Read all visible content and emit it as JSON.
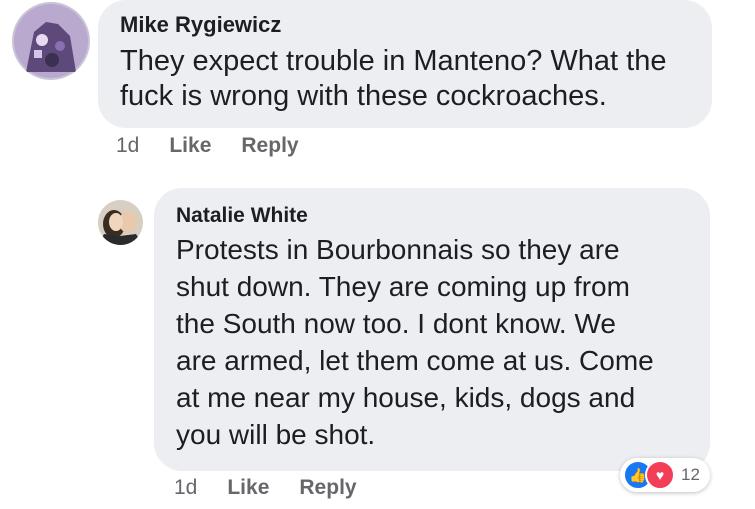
{
  "comments": [
    {
      "author": "Mike Rygiewicz",
      "text": "They expect trouble in Manteno? What the\nfuck is wrong with these cockroaches.",
      "time": "1d",
      "like_label": "Like",
      "reply_label": "Reply"
    },
    {
      "author": "Natalie White",
      "text": "Protests in Bourbonnais so they are\nshut down.  They are coming up from\nthe South now too.  I dont know.  We\nare armed, let them come at us. Come\nat me near my house, kids, dogs and\nyou will be shot.",
      "time": "1d",
      "like_label": "Like",
      "reply_label": "Reply",
      "reactions": {
        "icons": [
          "like-icon",
          "love-icon"
        ],
        "like_glyph": "👍",
        "love_glyph": "♥",
        "count": "12"
      }
    }
  ],
  "colors": {
    "bubble": "#edeef2",
    "text": "#1c1e21",
    "meta": "#65676b",
    "like_blue": "#1877f2",
    "love_red": "#f33e58"
  }
}
